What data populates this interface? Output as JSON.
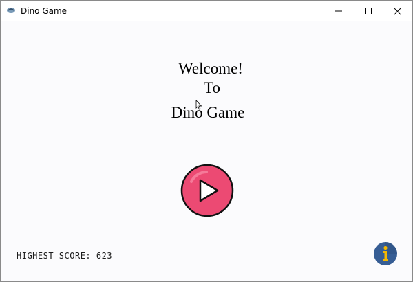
{
  "window": {
    "title": "Dino Game"
  },
  "welcome": {
    "line1": "Welcome!",
    "line2": "To",
    "line3": "Dino Game"
  },
  "score": {
    "text": "HIGHEST SCORE: 623"
  },
  "colors": {
    "play_fill": "#ec4a73",
    "play_highlight": "#f57a99",
    "info_fill": "#365d94",
    "info_glyph": "#f5b800"
  },
  "icons": {
    "app": "dino-app-icon",
    "minimize": "minimize-icon",
    "maximize": "maximize-icon",
    "close": "close-icon",
    "play": "play-icon",
    "info": "info-icon"
  }
}
